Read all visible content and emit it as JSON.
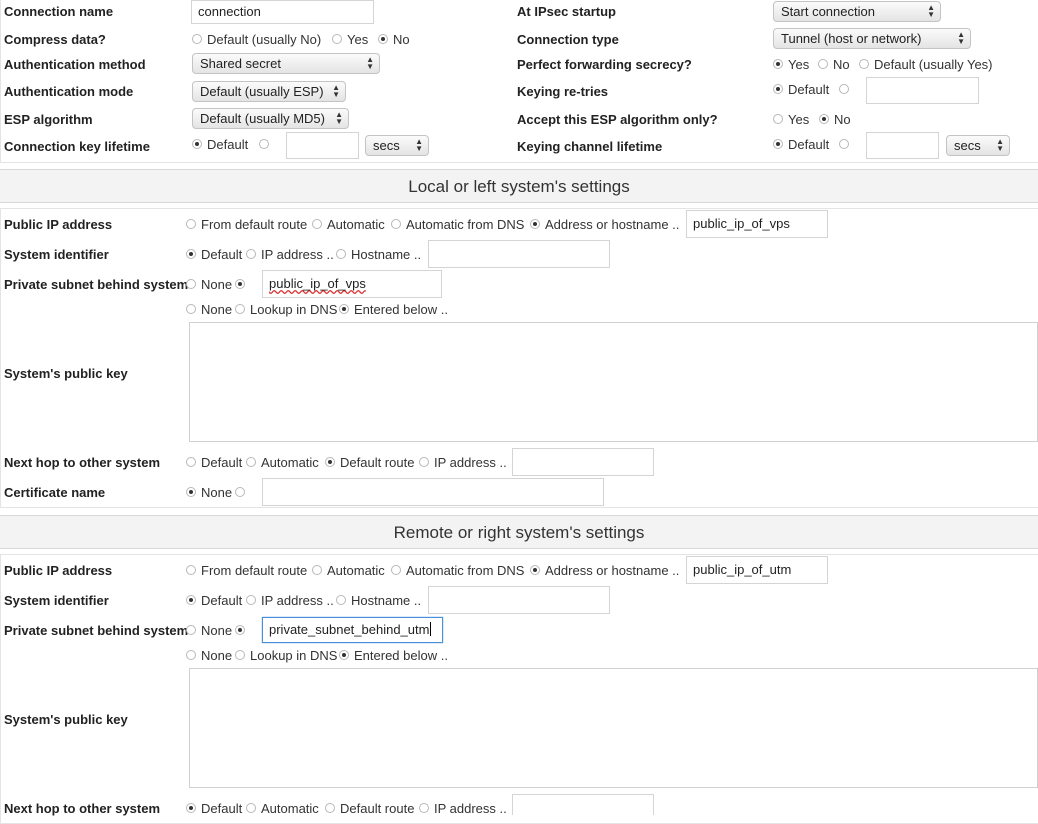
{
  "general": {
    "conn_name_label": "Connection name",
    "conn_name_value": "connection",
    "compress_label": "Compress data?",
    "compress_opts": [
      "Default (usually No)",
      "Yes",
      "No"
    ],
    "auth_method_label": "Authentication method",
    "auth_method_value": "Shared secret",
    "auth_mode_label": "Authentication mode",
    "auth_mode_value": "Default (usually ESP)",
    "esp_label": "ESP algorithm",
    "esp_value": "Default (usually MD5)",
    "key_lifetime_label": "Connection key lifetime",
    "default_opt": "Default",
    "secs": "secs",
    "startup_label": "At IPsec startup",
    "startup_value": "Start connection",
    "conn_type_label": "Connection type",
    "conn_type_value": "Tunnel (host or network)",
    "pfs_label": "Perfect forwarding secrecy?",
    "pfs_opts": [
      "Yes",
      "No",
      "Default (usually Yes)"
    ],
    "retries_label": "Keying re-tries",
    "esp_only_label": "Accept this ESP algorithm only?",
    "esp_only_opts": [
      "Yes",
      "No"
    ],
    "keying_channel_label": "Keying channel lifetime"
  },
  "local": {
    "title": "Local or left system's settings",
    "public_ip_label": "Public IP address",
    "public_ip_opts": [
      "From default route",
      "Automatic",
      "Automatic from DNS",
      "Address or hostname .."
    ],
    "public_ip_value": "public_ip_of_vps",
    "sysid_label": "System identifier",
    "sysid_opts": [
      "Default",
      "IP address ..",
      "Hostname .."
    ],
    "subnet_label": "Private subnet behind system",
    "subnet_none": "None",
    "subnet_value": "public_ip_of_vps",
    "key_opts": [
      "None",
      "Lookup in DNS",
      "Entered below .."
    ],
    "pubkey_label": "System's public key",
    "nexthop_label": "Next hop to other system",
    "nexthop_opts": [
      "Default",
      "Automatic",
      "Default route",
      "IP address .."
    ],
    "cert_label": "Certificate name",
    "cert_none": "None"
  },
  "remote": {
    "title": "Remote or right system's settings",
    "public_ip_label": "Public IP address",
    "public_ip_opts": [
      "From default route",
      "Automatic",
      "Automatic from DNS",
      "Address or hostname .."
    ],
    "public_ip_value": "public_ip_of_utm",
    "sysid_label": "System identifier",
    "sysid_opts": [
      "Default",
      "IP address ..",
      "Hostname .."
    ],
    "subnet_label": "Private subnet behind system",
    "subnet_none": "None",
    "subnet_value": "private_subnet_behind_utm",
    "key_opts": [
      "None",
      "Lookup in DNS",
      "Entered below .."
    ],
    "pubkey_label": "System's public key",
    "nexthop_label": "Next hop to other system",
    "nexthop_opts": [
      "Default",
      "Automatic",
      "Default route",
      "IP address .."
    ]
  }
}
